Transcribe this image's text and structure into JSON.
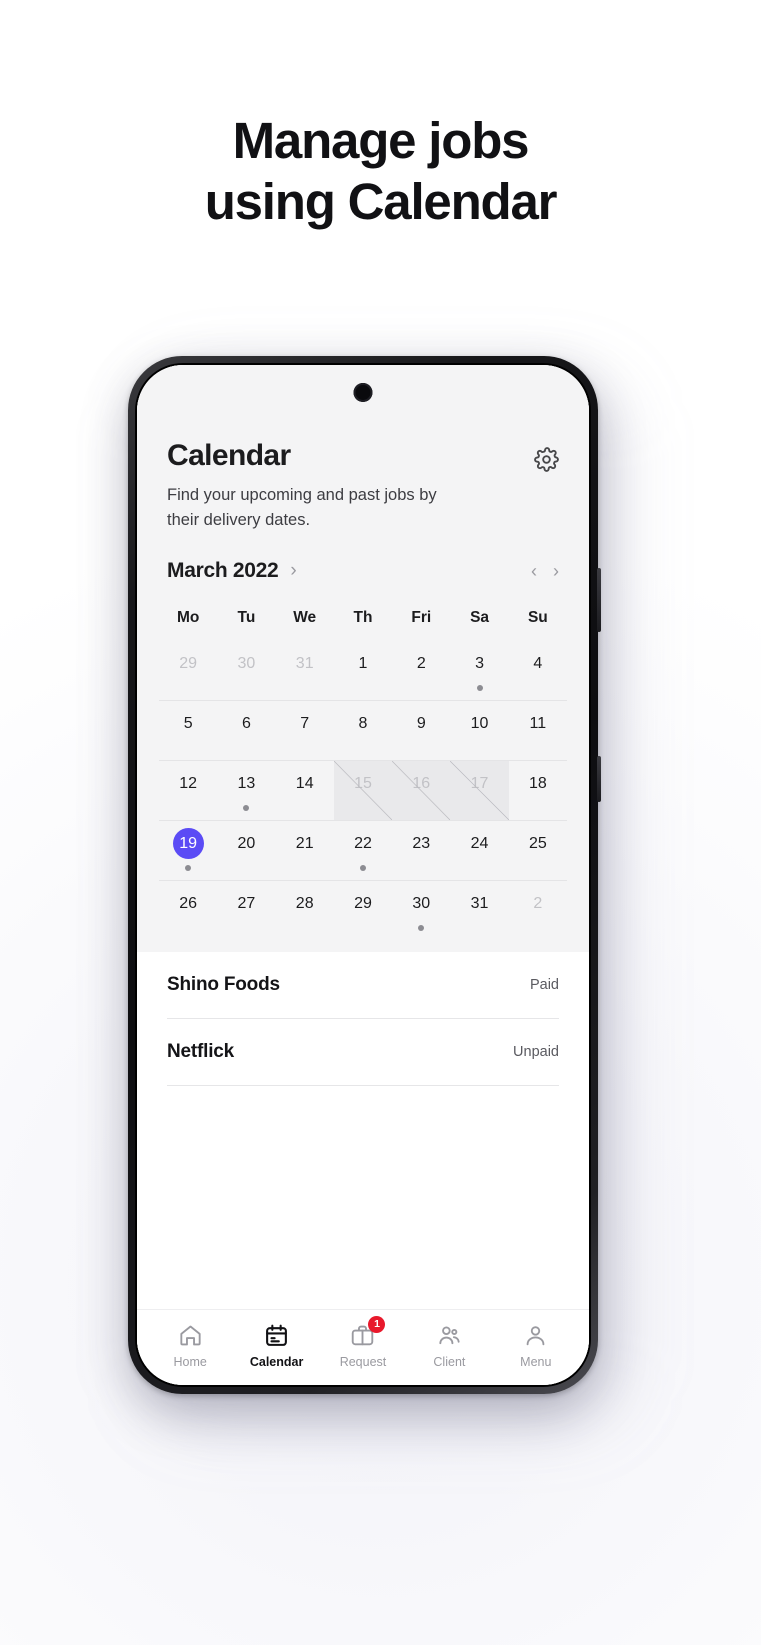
{
  "headline": {
    "line1": "Manage jobs",
    "line2": "using Calendar"
  },
  "app": {
    "title": "Calendar",
    "subtitle": "Find your upcoming and past jobs by their delivery dates.",
    "settings_icon": "gear-icon"
  },
  "month": {
    "label": "March 2022",
    "expand_chevron": "›",
    "prev_chevron": "‹",
    "next_chevron": "›"
  },
  "calendar": {
    "weekdays": [
      "Mo",
      "Tu",
      "We",
      "Th",
      "Fri",
      "Sa",
      "Su"
    ],
    "accent_color": "#5b4bf5",
    "weeks": [
      [
        {
          "day": "29",
          "muted": true
        },
        {
          "day": "30",
          "muted": true
        },
        {
          "day": "31",
          "muted": true
        },
        {
          "day": "1"
        },
        {
          "day": "2"
        },
        {
          "day": "3",
          "dot": true
        },
        {
          "day": "4"
        }
      ],
      [
        {
          "day": "5"
        },
        {
          "day": "6"
        },
        {
          "day": "7"
        },
        {
          "day": "8"
        },
        {
          "day": "9"
        },
        {
          "day": "10"
        },
        {
          "day": "11"
        }
      ],
      [
        {
          "day": "12"
        },
        {
          "day": "13",
          "dot": true
        },
        {
          "day": "14"
        },
        {
          "day": "15",
          "blocked": true
        },
        {
          "day": "16",
          "blocked": true
        },
        {
          "day": "17",
          "blocked": true
        },
        {
          "day": "18"
        }
      ],
      [
        {
          "day": "19",
          "selected": true,
          "dot": true
        },
        {
          "day": "20"
        },
        {
          "day": "21"
        },
        {
          "day": "22",
          "dot": true
        },
        {
          "day": "23"
        },
        {
          "day": "24"
        },
        {
          "day": "25"
        }
      ],
      [
        {
          "day": "26"
        },
        {
          "day": "27"
        },
        {
          "day": "28"
        },
        {
          "day": "29"
        },
        {
          "day": "30",
          "dot": true
        },
        {
          "day": "31"
        },
        {
          "day": "2",
          "muted": true
        }
      ]
    ]
  },
  "jobs": [
    {
      "name": "Shino Foods",
      "status": "Paid"
    },
    {
      "name": "Netflick",
      "status": "Unpaid"
    }
  ],
  "tabbar": [
    {
      "label": "Home",
      "icon": "home-icon",
      "active": false
    },
    {
      "label": "Calendar",
      "icon": "calendar-icon",
      "active": true
    },
    {
      "label": "Request",
      "icon": "briefcase-icon",
      "active": false,
      "badge": "1"
    },
    {
      "label": "Client",
      "icon": "people-icon",
      "active": false
    },
    {
      "label": "Menu",
      "icon": "person-icon",
      "active": false
    }
  ]
}
